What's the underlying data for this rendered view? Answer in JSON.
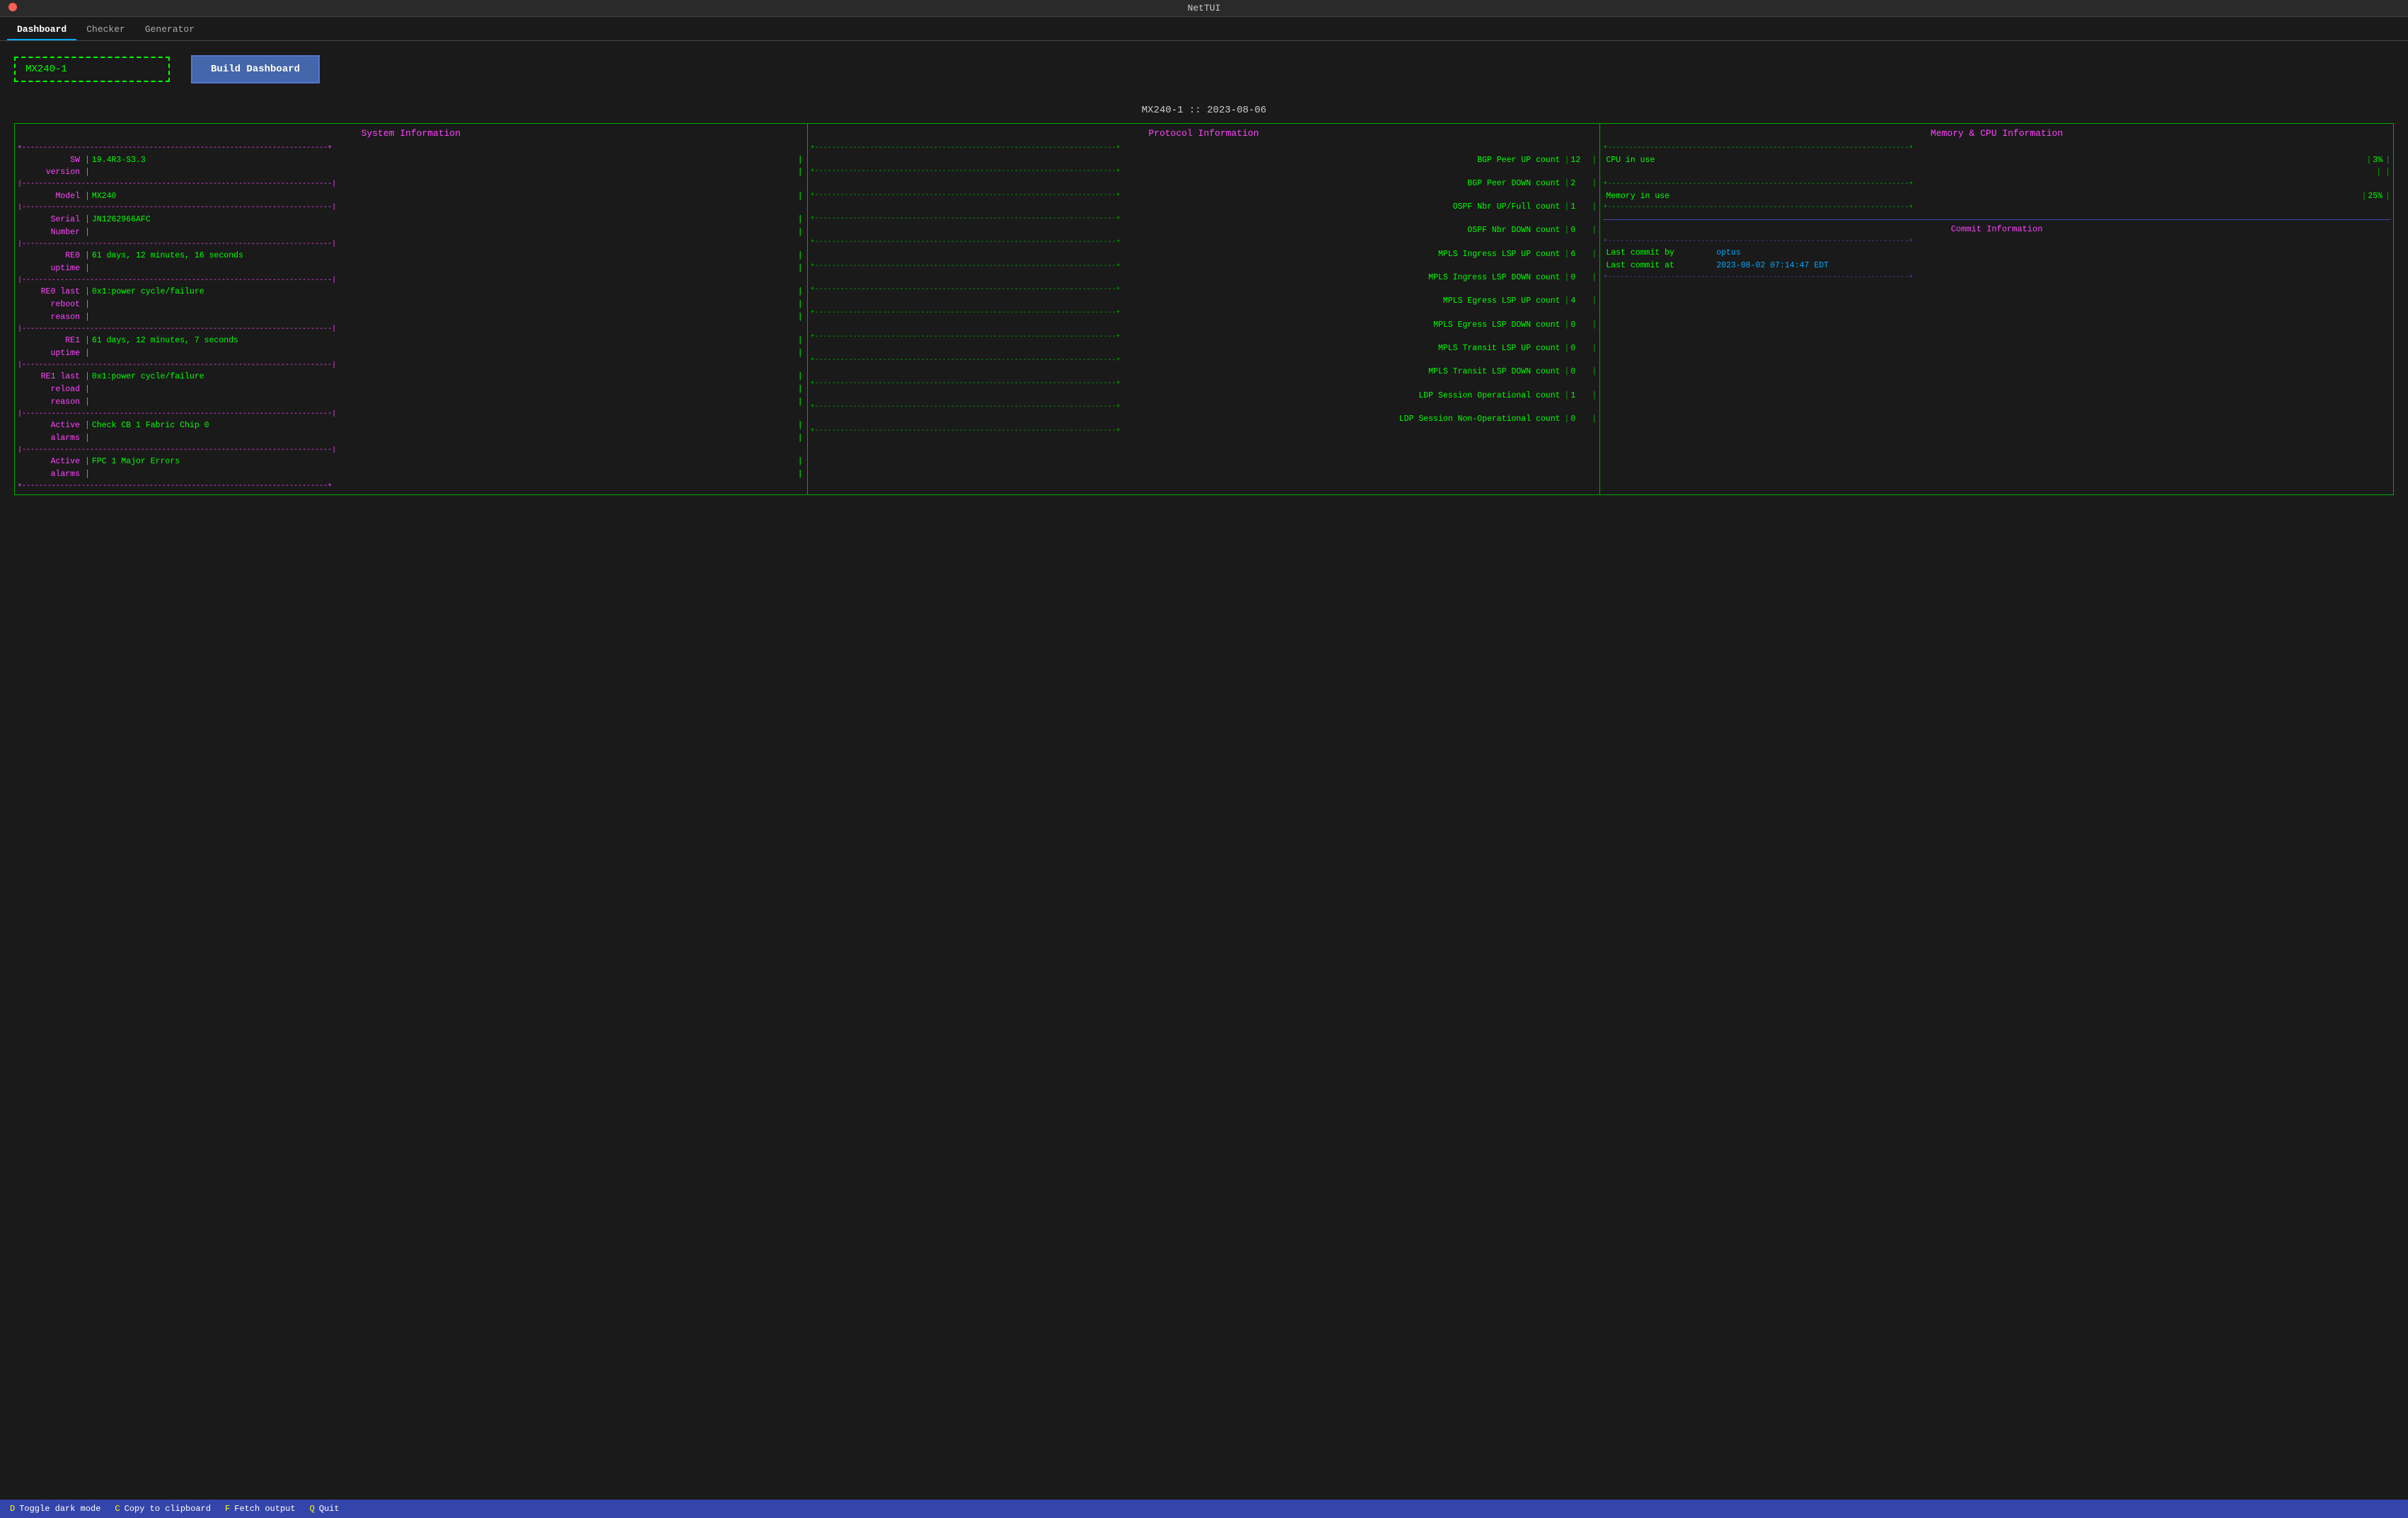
{
  "app": {
    "title": "NetTUI"
  },
  "tabs": [
    {
      "label": "Dashboard",
      "active": true
    },
    {
      "label": "Checker",
      "active": false
    },
    {
      "label": "Generator",
      "active": false
    }
  ],
  "device_input": {
    "value": "MX240-1",
    "placeholder": "MX240-1"
  },
  "build_button": {
    "label": "Build Dashboard"
  },
  "dashboard": {
    "title": "MX240-1 :: 2023-08-06",
    "system_panel": {
      "title": "System Information",
      "rows": [
        {
          "label": "SW\n    version",
          "value": "19.4R3-S3.3"
        },
        {
          "label": "Model",
          "value": "MX240"
        },
        {
          "label": "Serial\n    Number",
          "value": "JN1262966AFC"
        },
        {
          "label": "RE0\n    uptime",
          "value": "61 days, 12 minutes, 16 seconds"
        },
        {
          "label": "RE0 last\n    reboot\n    reason",
          "value": "0x1:power cycle/failure"
        },
        {
          "label": "RE1\n    uptime",
          "value": "61 days, 12 minutes, 7 seconds"
        },
        {
          "label": "RE1 last\n    reload\n    reason",
          "value": "0x1:power cycle/failure"
        },
        {
          "label": "Active\n    alarms",
          "value": "Check CB 1 Fabric Chip 0"
        },
        {
          "label": "Active\n    alarms",
          "value": "FPC 1 Major Errors"
        }
      ]
    },
    "protocol_panel": {
      "title": "Protocol Information",
      "rows": [
        {
          "label": "BGP Peer UP count",
          "value": "12"
        },
        {
          "label": "BGP Peer DOWN count",
          "value": "2"
        },
        {
          "label": "OSPF Nbr UP/Full count",
          "value": "1"
        },
        {
          "label": "OSPF Nbr DOWN count",
          "value": "0"
        },
        {
          "label": "MPLS Ingress LSP UP count",
          "value": "6"
        },
        {
          "label": "MPLS Ingress LSP DOWN count",
          "value": "0"
        },
        {
          "label": "MPLS Egress LSP UP count",
          "value": "4"
        },
        {
          "label": "MPLS Egress LSP DOWN count",
          "value": "0"
        },
        {
          "label": "MPLS Transit LSP UP count",
          "value": "0"
        },
        {
          "label": "MPLS Transit LSP DOWN count",
          "value": "0"
        },
        {
          "label": "LDP Session Operational count",
          "value": "1"
        },
        {
          "label": "LDP Session Non-Operational count",
          "value": "0"
        }
      ]
    },
    "memory_panel": {
      "title": "Memory & CPU Information",
      "rows": [
        {
          "label": "CPU in use",
          "value": "3%"
        },
        {
          "label": "Memory in use",
          "value": "25%"
        }
      ],
      "commit": {
        "title": "Commit Information",
        "rows": [
          {
            "label": "Last commit by",
            "value": "optus"
          },
          {
            "label": "Last commit at",
            "value": "2023-08-02 07:14:47 EDT"
          }
        ]
      }
    }
  },
  "statusbar": {
    "items": [
      {
        "key": "D",
        "label": "Toggle dark mode"
      },
      {
        "key": "C",
        "label": "Copy to clipboard"
      },
      {
        "key": "F",
        "label": "Fetch output"
      },
      {
        "key": "Q",
        "label": "Quit"
      }
    ]
  }
}
